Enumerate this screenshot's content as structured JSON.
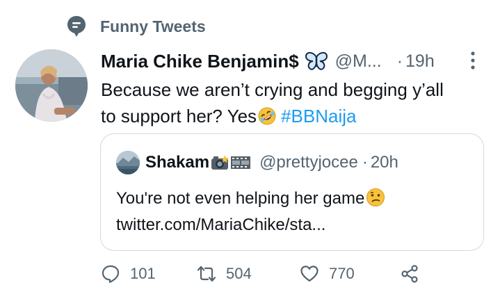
{
  "topic": {
    "label": "Funny Tweets",
    "icon": "topic-icon"
  },
  "tweet": {
    "author": "Maria Chike Benjamin$",
    "handle": "@M...",
    "dot": "·",
    "time": "19h",
    "text_line1": "Because we aren’t crying and begging y’all",
    "text_line2_prefix": "to support her? Yes",
    "hashtag": "#BBNaija",
    "emoji": "rolling-on-floor-laughing",
    "author_badge_icon": "butterfly-icon",
    "menu_icon": "more-icon"
  },
  "quote": {
    "author": "Shakam",
    "author_badges": [
      "camera-flash-icon",
      "film-frames-icon"
    ],
    "handle": "@prettyjocee",
    "dot": "·",
    "time": "20h",
    "text_line1": "You're not even helping her game",
    "emoji": "confused-face",
    "text_line2": "twitter.com/MariaChike/sta..."
  },
  "actions": {
    "replies": "101",
    "retweets": "504",
    "likes": "770",
    "share_icon": "share-icon"
  },
  "colors": {
    "text": "#0f1419",
    "secondary": "#536471",
    "link": "#1d9bf0",
    "border": "#cfd9de",
    "background": "#ffffff"
  }
}
